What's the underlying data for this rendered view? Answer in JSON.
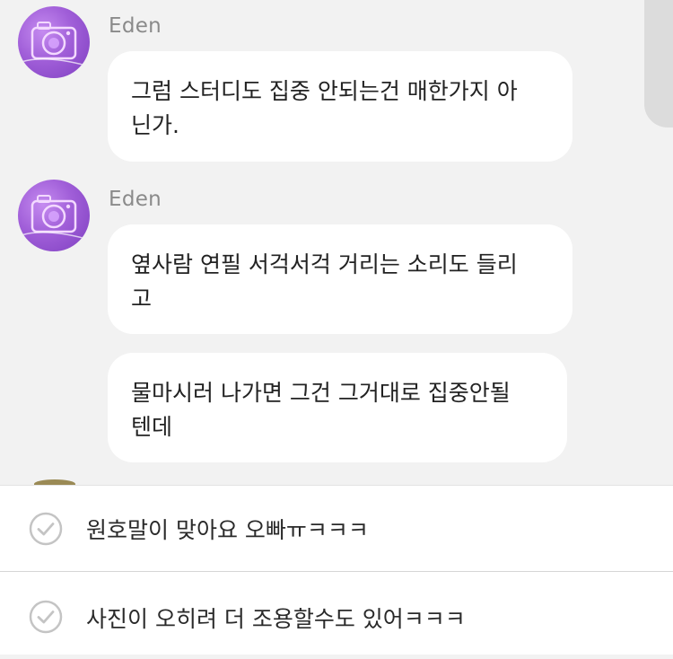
{
  "chat": {
    "messages": [
      {
        "sender": "Eden",
        "avatar_icon": "camera-avatar-icon",
        "bubbles": [
          {
            "lines": [
              "그럼 스터디도 집중 안되는건 매한가지 아",
              "닌가."
            ]
          }
        ]
      },
      {
        "sender": "Eden",
        "avatar_icon": "camera-avatar-icon",
        "bubbles": [
          {
            "lines": [
              "옆사람 연필 서걱서걱 거리는 소리도 들리",
              "고"
            ]
          },
          {
            "lines": [
              "물마시러 나가면 그건 그거대로 집중안될",
              "텐데"
            ]
          }
        ]
      }
    ]
  },
  "quick_replies": [
    {
      "label": "원호말이 맞아요 오빠ㅠㅋㅋㅋ",
      "icon": "check-circle-icon"
    },
    {
      "label": "사진이 오히려 더 조용할수도 있어ㅋㅋㅋ",
      "icon": "check-circle-icon"
    }
  ],
  "colors": {
    "background": "#f2f2f2",
    "bubble": "#ffffff",
    "sender_name": "#8a8a8a",
    "avatar": "#a05ed8",
    "check_icon": "#c4c4c4"
  }
}
